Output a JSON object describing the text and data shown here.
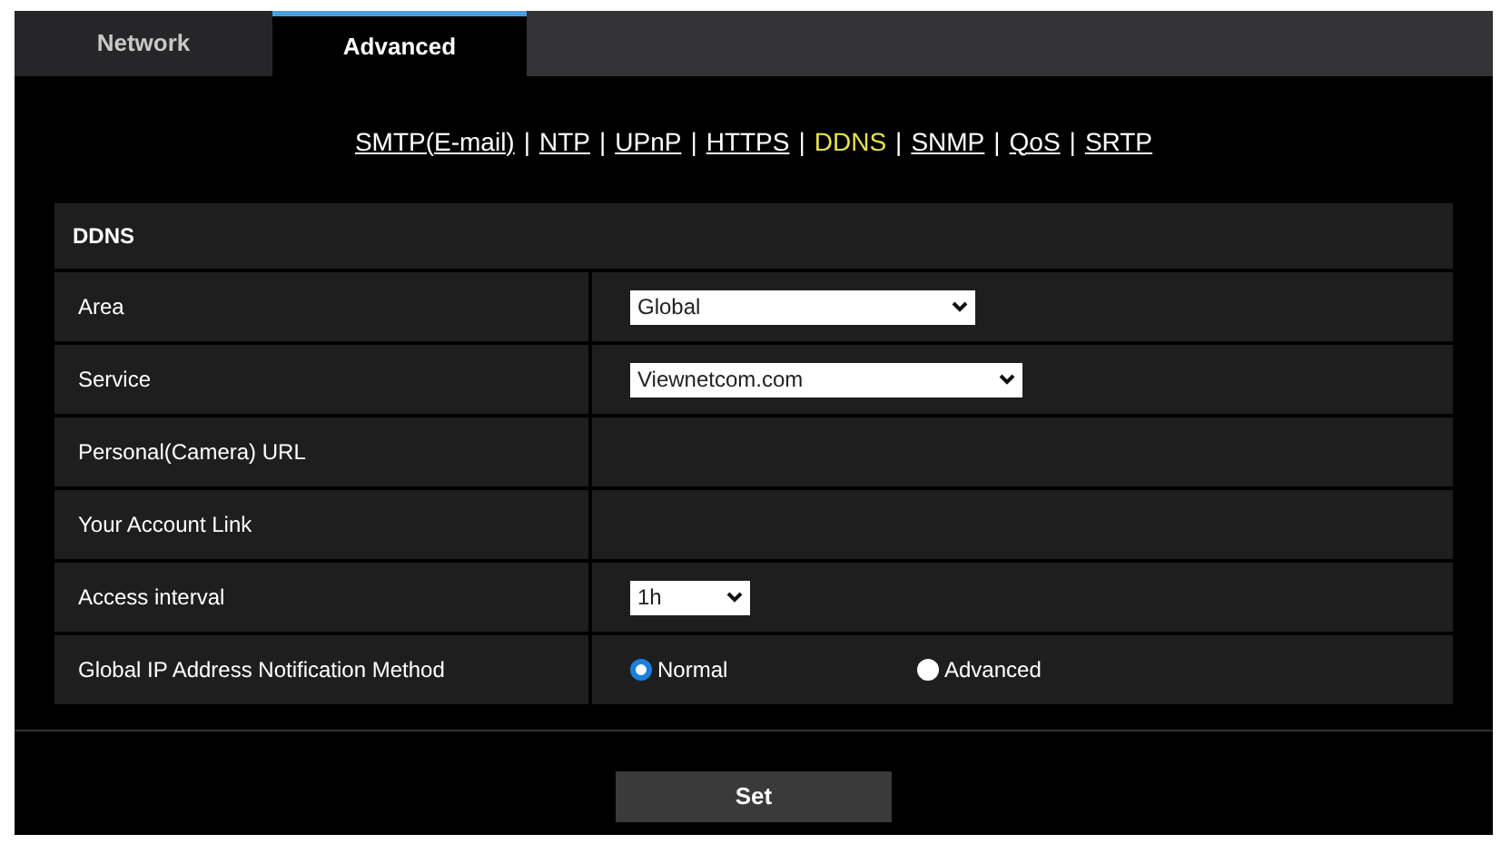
{
  "tabs": [
    {
      "label": "Network",
      "selected": false
    },
    {
      "label": "Advanced",
      "selected": true
    }
  ],
  "links": [
    {
      "label": "SMTP(E-mail)",
      "selected": false
    },
    {
      "label": "NTP",
      "selected": false
    },
    {
      "label": "UPnP",
      "selected": false
    },
    {
      "label": "HTTPS",
      "selected": false
    },
    {
      "label": "DDNS",
      "selected": true
    },
    {
      "label": "SNMP",
      "selected": false
    },
    {
      "label": "QoS",
      "selected": false
    },
    {
      "label": "SRTP",
      "selected": false
    }
  ],
  "separator": "|",
  "section_title": "DDNS",
  "rows": [
    {
      "kind": "select",
      "label": "Area",
      "value": "Global"
    },
    {
      "kind": "select",
      "label": "Service",
      "value": "Viewnetcom.com"
    },
    {
      "kind": "empty",
      "label": "Personal(Camera) URL"
    },
    {
      "kind": "empty",
      "label": "Your Account Link"
    },
    {
      "kind": "select",
      "label": "Access interval",
      "value": "1h"
    },
    {
      "kind": "radio",
      "label": "Global IP Address Notification Method",
      "options": [
        {
          "label": "Normal",
          "selected": true
        },
        {
          "label": "Advanced",
          "selected": false
        }
      ]
    }
  ],
  "set_button": "Set"
}
